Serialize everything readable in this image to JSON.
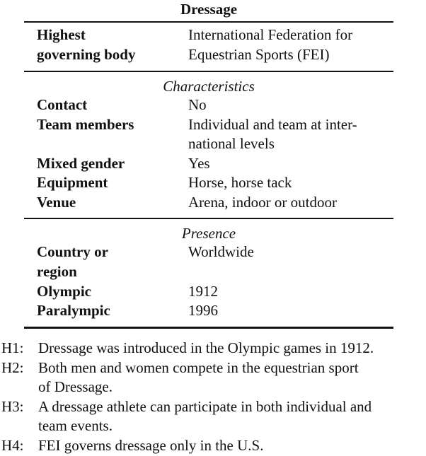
{
  "table": {
    "title": "Dressage",
    "header_row": {
      "key_lines": [
        "Highest",
        "governing body"
      ],
      "value_lines": [
        "International Federation for",
        "Equestrian Sports (FEI)"
      ]
    },
    "sections": [
      {
        "heading": "Characteristics",
        "rows": [
          {
            "key": "Contact",
            "value_lines": [
              "No"
            ]
          },
          {
            "key": "Team members",
            "value_lines": [
              "Individual and team at inter-",
              "national levels"
            ]
          },
          {
            "key": "Mixed gender",
            "value_lines": [
              "Yes"
            ]
          },
          {
            "key": "Equipment",
            "value_lines": [
              "Horse, horse tack"
            ]
          },
          {
            "key": "Venue",
            "value_lines": [
              "Arena, indoor or outdoor"
            ]
          }
        ]
      },
      {
        "heading": "Presence",
        "rows": [
          {
            "key_lines": [
              "Country or",
              "region"
            ],
            "value_lines": [
              "Worldwide"
            ]
          },
          {
            "key": "Olympic",
            "value_lines": [
              "1912"
            ]
          },
          {
            "key": "Paralympic",
            "value_lines": [
              "1996"
            ]
          }
        ]
      }
    ]
  },
  "hypotheses": [
    {
      "label": "H1:",
      "lines": [
        "Dressage was introduced in the Olympic games in 1912."
      ]
    },
    {
      "label": "H2:",
      "lines": [
        "Both men and women compete in the equestrian sport",
        "of Dressage."
      ]
    },
    {
      "label": "H3:",
      "lines": [
        "A dressage athlete can participate in both individual and",
        "team events."
      ]
    },
    {
      "label": "H4:",
      "lines": [
        "FEI governs dressage only in the U.S."
      ]
    }
  ]
}
